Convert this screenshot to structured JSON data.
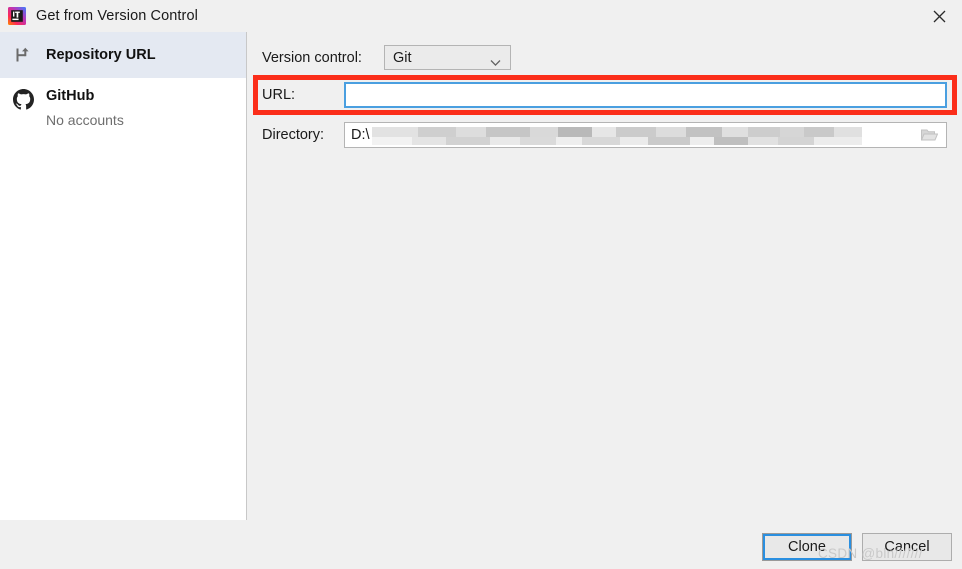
{
  "window": {
    "title": "Get from Version Control",
    "app_icon": "intellij-idea-icon",
    "close_label": "✕"
  },
  "sidebar": {
    "items": [
      {
        "id": "repository-url",
        "label": "Repository URL",
        "icon": "vcs-branch-icon",
        "selected": true,
        "subtitle": ""
      },
      {
        "id": "github",
        "label": "GitHub",
        "icon": "github-icon",
        "selected": false,
        "subtitle": "No accounts"
      }
    ]
  },
  "main": {
    "version_control": {
      "label": "Version control:",
      "value": "Git",
      "options": [
        "Git"
      ],
      "chevron": "chevron-down-icon"
    },
    "url": {
      "label": "URL:",
      "value": "",
      "placeholder": "",
      "highlighted": true,
      "highlight_color": "#fb2e1a",
      "focus_color": "#4a9fe0"
    },
    "directory": {
      "label": "Directory:",
      "value": "D:\\",
      "browse_icon": "folder-icon"
    }
  },
  "footer": {
    "clone_label": "Clone",
    "cancel_label": "Cancel",
    "focus_color": "#2a8fe0"
  },
  "watermark": {
    "text": "CSDN @bln///////"
  }
}
